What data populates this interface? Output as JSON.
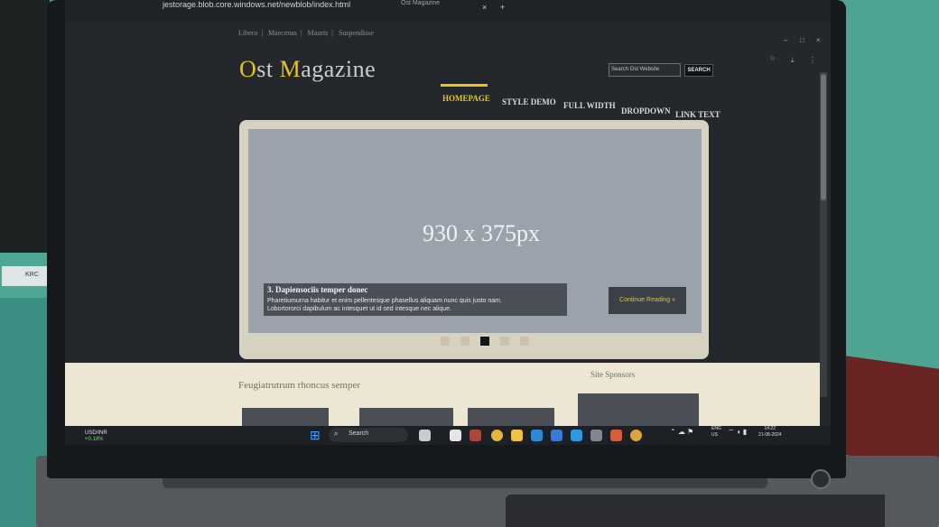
{
  "browser": {
    "url": "jestorage.blob.core.windows.net/newblob/index.html",
    "tab_title": "Ost Magazine",
    "close_glyph": "×",
    "newtab_glyph": "+"
  },
  "site": {
    "top_links": [
      "Libero",
      "Maecenas",
      "Mauris",
      "Suspendisse"
    ],
    "logo_o": "O",
    "logo_st": "st ",
    "logo_m": "M",
    "logo_agazine": "agazine",
    "search_placeholder": "Search Ost Website",
    "search_button": "SEARCH",
    "menu": [
      "HOMEPAGE",
      "STYLE DEMO",
      "FULL WIDTH",
      "DROPDOWN",
      "LINK TEXT"
    ],
    "slider": {
      "size_label": "930 x 375px",
      "caption_title": "3. Dapiensociis temper donec",
      "caption_line1": "Pharetiumurna habitur et enim pellentesque phasellus aliquam nunc quis justo nam.",
      "caption_line2": "Lobortororci dapibulum ac intesquet ut id sed intesque nec alique.",
      "continue_label": "Continue Reading »",
      "active_slide": 3,
      "slide_count": 5
    },
    "section_title": "Feugiatrutrum rhoncus semper",
    "sponsors_title": "Site Sponsors"
  },
  "taskbar": {
    "weather_pair": "USD/INR",
    "weather_change": "+0.18%",
    "search_label": "Search",
    "lang_top": "ENG",
    "lang_bottom": "US",
    "time": "14:22",
    "date": "21-08-2024"
  },
  "colors": {
    "accent": "#e8c51d",
    "page_bg": "#24272b",
    "slider_bg": "#9aa2ac"
  }
}
